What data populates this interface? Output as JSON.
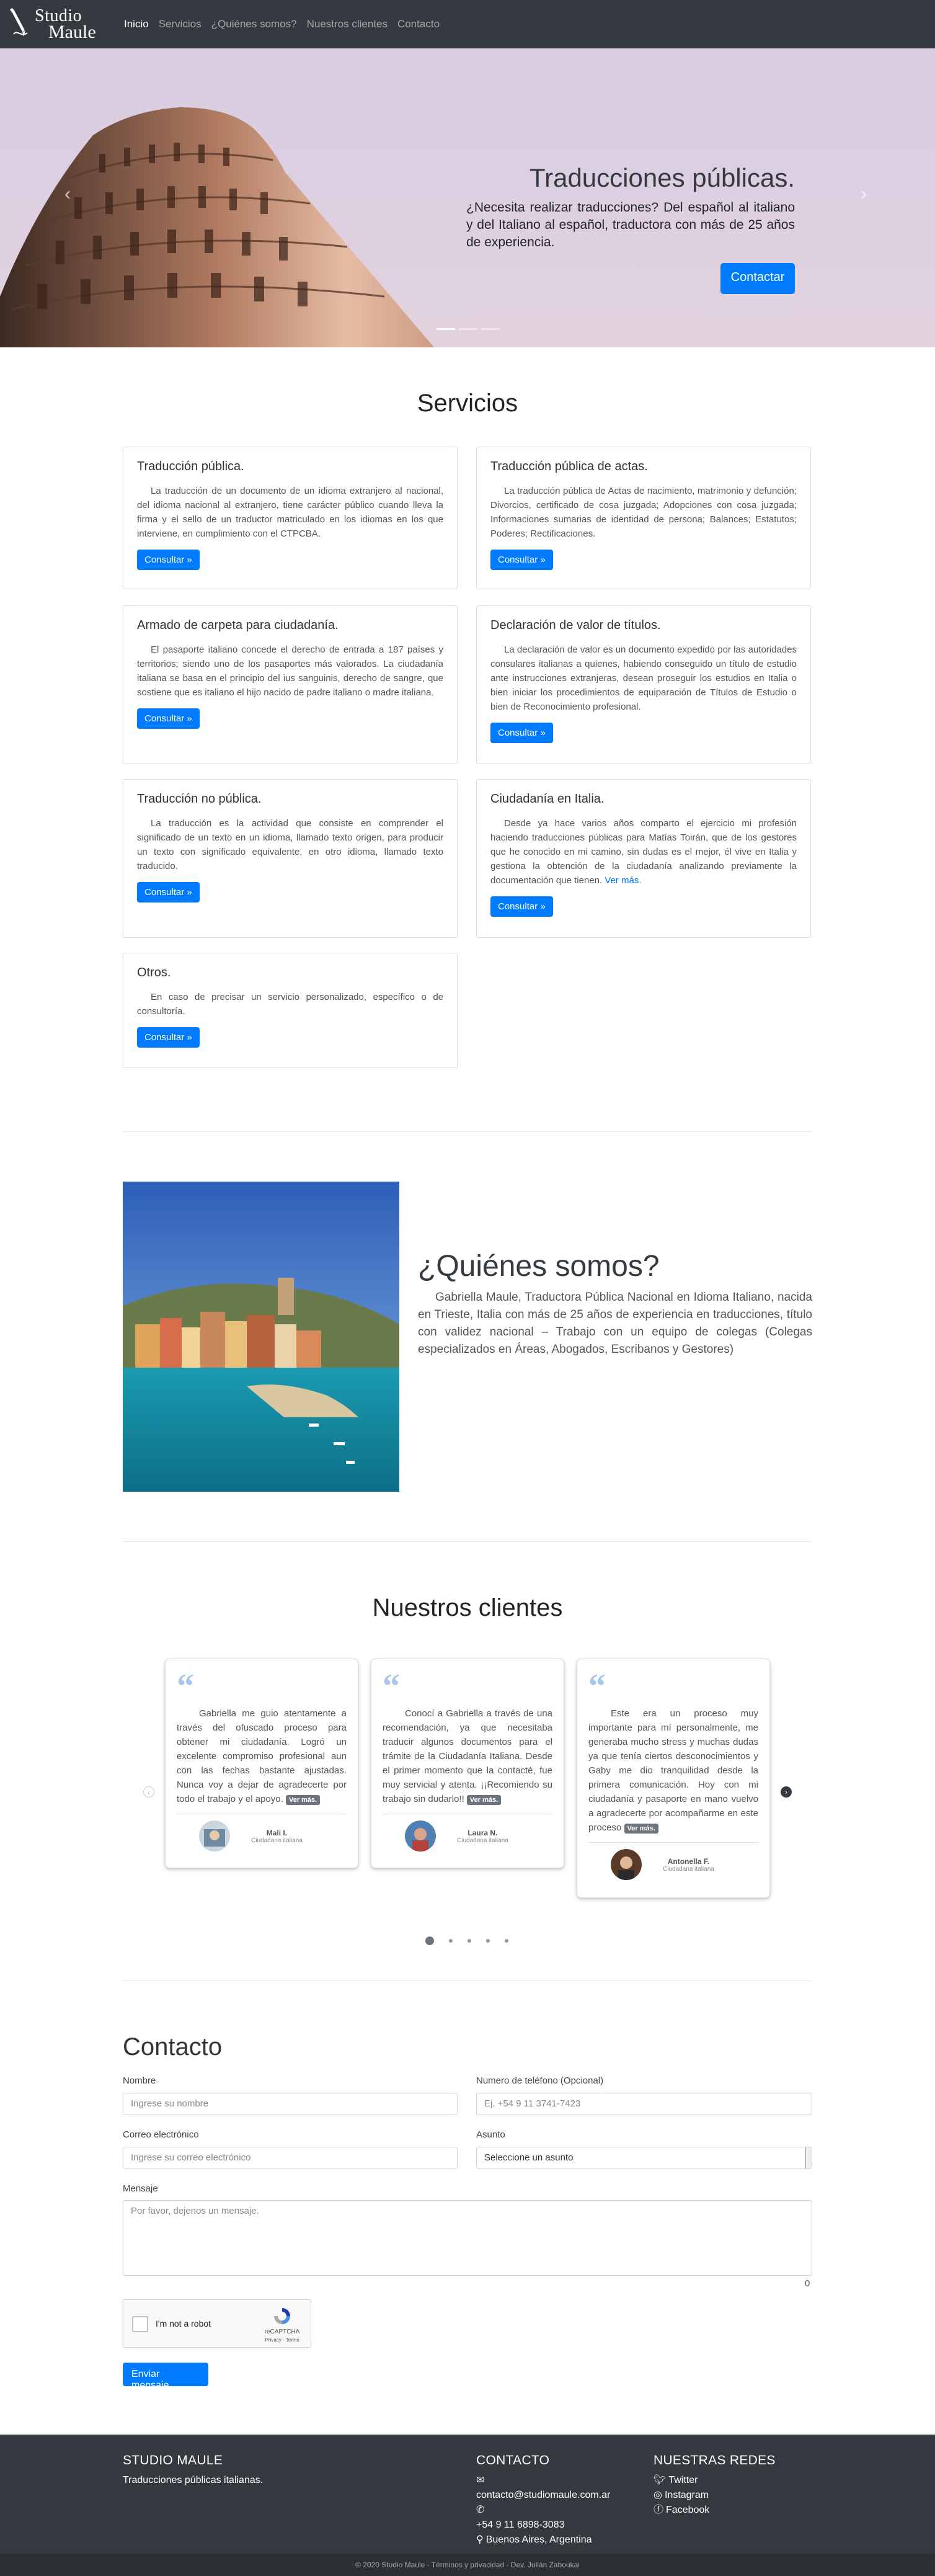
{
  "nav": {
    "brand_line1": "Studio",
    "brand_line2": "Maule",
    "items": [
      "Inicio",
      "Servicios",
      "¿Quiénes somos?",
      "Nuestros clientes",
      "Contacto"
    ]
  },
  "hero": {
    "title": "Traducciones públicas.",
    "text": "¿Necesita realizar traducciones? Del español al italiano y del Italiano al español, traductora con más de 25 años de experiencia.",
    "button": "Contactar",
    "prev": "‹",
    "next": "›"
  },
  "services": {
    "title": "Servicios",
    "button": "Consultar »",
    "items": [
      {
        "title": "Traducción pública.",
        "text": "La traducción de un documento de un idioma extranjero al nacional, del idioma nacional al extranjero, tiene carácter público cuando lleva la firma y el sello de un traductor matriculado en los idiomas en los que interviene, en cumplimiento con el CTPCBA."
      },
      {
        "title": "Traducción pública de actas.",
        "text": "La traducción pública de Actas de nacimiento, matrimonio y defunción; Divorcios, certificado de cosa juzgada; Adopciones con cosa juzgada; Informaciones sumarias de identidad de persona; Balances; Estatutos; Poderes; Rectificaciones."
      },
      {
        "title": "Armado de carpeta para ciudadanía.",
        "text": "El pasaporte italiano concede el derecho de entrada a 187 países y territorios; siendo uno de los pasaportes más valorados. La ciudadanía italiana se basa en el principio del ius sanguinis, derecho de sangre, que sostiene que es italiano el hijo nacido de padre italiano o madre italiana."
      },
      {
        "title": "Declaración de valor de títulos.",
        "text": "La declaración de valor es un documento expedido por las autoridades consulares italianas a quienes, habiendo conseguido un título de estudio ante instrucciones extranjeras, desean proseguir los estudios en Italia o bien iniciar los procedimientos de equiparación de Títulos de Estudio o bien de Reconocimiento profesional."
      },
      {
        "title": "Traducción no pública.",
        "text": "La traducción es la actividad que consiste en comprender el significado de un texto en un idioma, llamado texto origen, para producir un texto con significado equivalente, en otro idioma, llamado texto traducido."
      },
      {
        "title": "Ciudadanía en Italia.",
        "text": "Desde ya hace varios años comparto el ejercicio mi profesión haciendo traducciones públicas para Matías Toirán, que de los gestores que he conocido en mi camino, sin dudas es el mejor, él vive en Italia y gestiona la obtención de la ciudadanía analizando previamente la documentación que tienen.",
        "more": "Ver más."
      },
      {
        "title": "Otros.",
        "text": "En caso de precisar un servicio personalizado, específico o de consultoría."
      }
    ]
  },
  "about": {
    "title": "¿Quiénes somos?",
    "text": "Gabriella Maule, Traductora Pública Nacional en Idioma Italiano, nacida en Trieste, Italia con más de 25 años de experiencia en traducciones, título con validez nacional – Trabajo con un equipo de colegas (Colegas especializados en Áreas, Abogados, Escribanos y Gestores)"
  },
  "clients": {
    "title": "Nuestros clientes",
    "more": "Ver más.",
    "testimonials": [
      {
        "text": "Gabriella me guio atentamente a través del ofuscado proceso para obtener mi ciudadanía. Logró un excelente compromiso profesional aun con las fechas bastante ajustadas. Nunca voy a dejar de agradecerte por todo el trabajo y el apoyo.",
        "name": "Mali I.",
        "role": "Ciudadana italiana"
      },
      {
        "text": "Conocí a Gabriella a través de una recomendación, ya que necesitaba traducir algunos documentos para el trámite de la Ciudadanía Italiana. Desde el primer momento que la contacté, fue muy servicial y atenta. ¡¡Recomiendo su trabajo sin dudarlo!!",
        "name": "Laura N.",
        "role": "Ciudadana italiana"
      },
      {
        "text": "Este era un proceso muy importante para mí personalmente, me generaba mucho stress y muchas dudas ya que tenía ciertos desconocimientos y Gaby me dio tranquilidad desde la primera comunicación. Hoy con mi ciudadanía y pasaporte en mano vuelvo a agradecerte por acompañarme en este proceso",
        "name": "Antonella F.",
        "role": "Ciudadana italiana"
      }
    ]
  },
  "contact": {
    "title": "Contacto",
    "name_label": "Nombre",
    "name_placeholder": "Ingrese su nombre",
    "phone_label": "Numero de teléfono (Opcional)",
    "phone_placeholder": "Ej. +54 9 11 3741-7423",
    "email_label": "Correo electrónico",
    "email_placeholder": "Ingrese su correo electrónico",
    "subject_label": "Asunto",
    "subject_value": "Seleccione un asunto",
    "message_label": "Mensaje",
    "message_placeholder": "Por favor, dejenos un mensaje.",
    "counter": "0",
    "captcha_label": "I'm not a robot",
    "captcha_brand": "reCAPTCHA",
    "captcha_links": "Privacy - Terms",
    "send": "Enviar mensaje"
  },
  "footer": {
    "col1_title": "STUDIO MAULE",
    "col1_text": "Traducciones públicas italianas.",
    "col2_title": "CONTACTO",
    "email": "contacto@studiomaule.com.ar",
    "phone": "+54 9 11 6898-3083",
    "location": "Buenos Aires, Argentina",
    "col3_title": "NUESTRAS REDES",
    "twitter": "Twitter",
    "instagram": "Instagram",
    "facebook": "Facebook",
    "bottom": "© 2020 Studio Maule · Términos y privacidad · Dev. Julián Zaboukai"
  }
}
